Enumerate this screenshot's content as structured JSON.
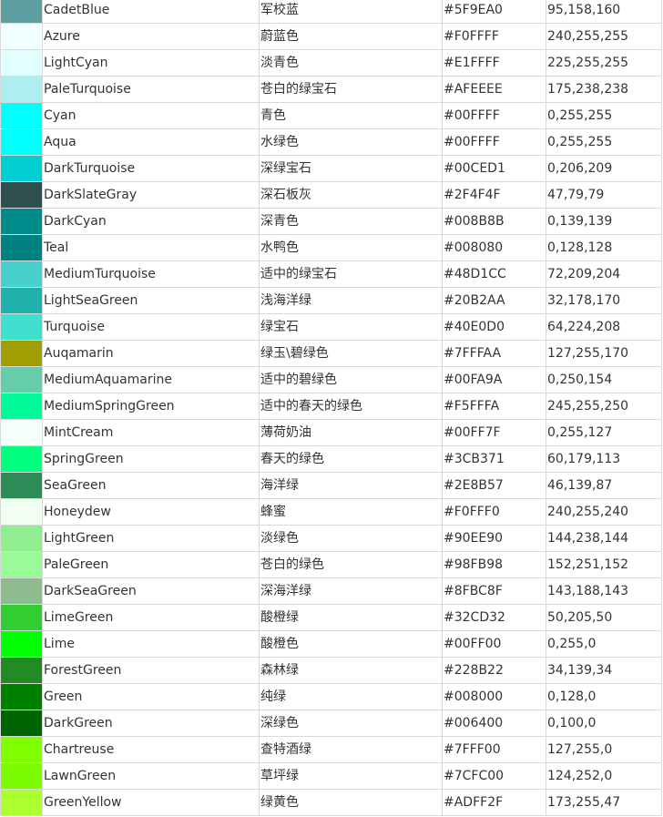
{
  "colors": [
    {
      "name": "CadetBlue",
      "cn": "军校蓝",
      "hex": "#5F9EA0",
      "rgb": "95,158,160",
      "swatch": "#5F9EA0"
    },
    {
      "name": "Azure",
      "cn": "蔚蓝色",
      "hex": "#F0FFFF",
      "rgb": "240,255,255",
      "swatch": "#F0FFFF"
    },
    {
      "name": "LightCyan",
      "cn": "淡青色",
      "hex": "#E1FFFF",
      "rgb": "225,255,255",
      "swatch": "#E1FFFF"
    },
    {
      "name": "PaleTurquoise",
      "cn": "苍白的绿宝石",
      "hex": "#AFEEEE",
      "rgb": "175,238,238",
      "swatch": "#AFEEEE"
    },
    {
      "name": "Cyan",
      "cn": "青色",
      "hex": "#00FFFF",
      "rgb": "0,255,255",
      "swatch": "#00FFFF"
    },
    {
      "name": "Aqua",
      "cn": "水绿色",
      "hex": "#00FFFF",
      "rgb": "0,255,255",
      "swatch": "#00FFFF"
    },
    {
      "name": "DarkTurquoise",
      "cn": "深绿宝石",
      "hex": "#00CED1",
      "rgb": "0,206,209",
      "swatch": "#00CED1"
    },
    {
      "name": "DarkSlateGray",
      "cn": "深石板灰",
      "hex": "#2F4F4F",
      "rgb": "47,79,79",
      "swatch": "#2F4F4F"
    },
    {
      "name": "DarkCyan",
      "cn": "深青色",
      "hex": "#008B8B",
      "rgb": "0,139,139",
      "swatch": "#008B8B"
    },
    {
      "name": "Teal",
      "cn": "水鸭色",
      "hex": "#008080",
      "rgb": "0,128,128",
      "swatch": "#008080"
    },
    {
      "name": "MediumTurquoise",
      "cn": "适中的绿宝石",
      "hex": "#48D1CC",
      "rgb": "72,209,204",
      "swatch": "#48D1CC"
    },
    {
      "name": "LightSeaGreen",
      "cn": "浅海洋绿",
      "hex": "#20B2AA",
      "rgb": "32,178,170",
      "swatch": "#20B2AA"
    },
    {
      "name": "Turquoise",
      "cn": "绿宝石",
      "hex": "#40E0D0",
      "rgb": "64,224,208",
      "swatch": "#40E0D0"
    },
    {
      "name": "Auqamarin",
      "cn": "绿玉\\碧绿色",
      "hex": "#7FFFAA",
      "rgb": "127,255,170",
      "swatch": "#A09E00"
    },
    {
      "name": "MediumAquamarine",
      "cn": "适中的碧绿色",
      "hex": "#00FA9A",
      "rgb": "0,250,154",
      "swatch": "#66CDAA"
    },
    {
      "name": "MediumSpringGreen",
      "cn": "适中的春天的绿色",
      "hex": "#F5FFFA",
      "rgb": "245,255,250",
      "swatch": "#00FA9A"
    },
    {
      "name": "MintCream",
      "cn": "薄荷奶油",
      "hex": "#00FF7F",
      "rgb": "0,255,127",
      "swatch": "#F5FFFA"
    },
    {
      "name": "SpringGreen",
      "cn": "春天的绿色",
      "hex": "#3CB371",
      "rgb": "60,179,113",
      "swatch": "#00FF7F"
    },
    {
      "name": "SeaGreen",
      "cn": "海洋绿",
      "hex": "#2E8B57",
      "rgb": "46,139,87",
      "swatch": "#2E8B57"
    },
    {
      "name": "Honeydew",
      "cn": "蜂蜜",
      "hex": "#F0FFF0",
      "rgb": "240,255,240",
      "swatch": "#F0FFF0"
    },
    {
      "name": "LightGreen",
      "cn": "淡绿色",
      "hex": "#90EE90",
      "rgb": "144,238,144",
      "swatch": "#90EE90"
    },
    {
      "name": "PaleGreen",
      "cn": "苍白的绿色",
      "hex": "#98FB98",
      "rgb": "152,251,152",
      "swatch": "#98FB98"
    },
    {
      "name": "DarkSeaGreen",
      "cn": "深海洋绿",
      "hex": "#8FBC8F",
      "rgb": "143,188,143",
      "swatch": "#8FBC8F"
    },
    {
      "name": "LimeGreen",
      "cn": "酸橙绿",
      "hex": "#32CD32",
      "rgb": "50,205,50",
      "swatch": "#32CD32"
    },
    {
      "name": "Lime",
      "cn": "酸橙色",
      "hex": "#00FF00",
      "rgb": "0,255,0",
      "swatch": "#00FF00"
    },
    {
      "name": "ForestGreen",
      "cn": "森林绿",
      "hex": "#228B22",
      "rgb": "34,139,34",
      "swatch": "#228B22"
    },
    {
      "name": "Green",
      "cn": "纯绿",
      "hex": "#008000",
      "rgb": "0,128,0",
      "swatch": "#008000"
    },
    {
      "name": "DarkGreen",
      "cn": "深绿色",
      "hex": "#006400",
      "rgb": "0,100,0",
      "swatch": "#006400"
    },
    {
      "name": "Chartreuse",
      "cn": "查特酒绿",
      "hex": "#7FFF00",
      "rgb": "127,255,0",
      "swatch": "#7FFF00"
    },
    {
      "name": "LawnGreen",
      "cn": "草坪绿",
      "hex": "#7CFC00",
      "rgb": "124,252,0",
      "swatch": "#7CFC00"
    },
    {
      "name": "GreenYellow",
      "cn": "绿黄色",
      "hex": "#ADFF2F",
      "rgb": "173,255,47",
      "swatch": "#ADFF2F"
    }
  ]
}
